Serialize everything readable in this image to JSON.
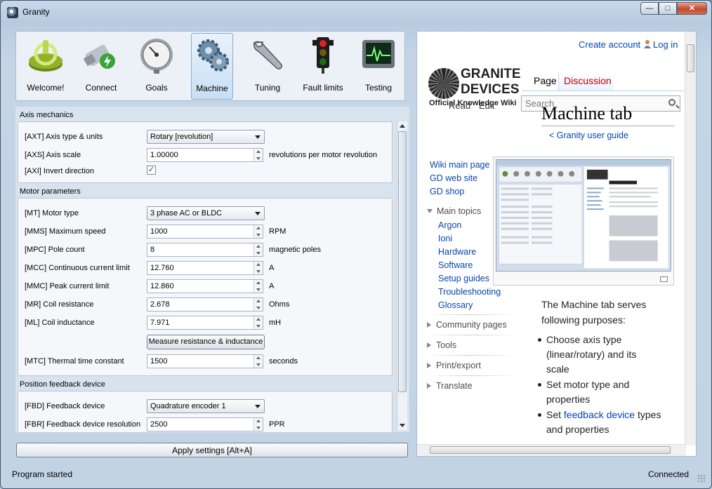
{
  "window": {
    "title": "Granity",
    "controls": [
      "minimize",
      "maximize",
      "close"
    ]
  },
  "toolbar": [
    {
      "label": "Welcome!",
      "icon": "power-icon"
    },
    {
      "label": "Connect",
      "icon": "usb-plug-icon"
    },
    {
      "label": "Goals",
      "icon": "gauge-icon"
    },
    {
      "label": "Machine",
      "icon": "gears-icon",
      "active": true
    },
    {
      "label": "Tuning",
      "icon": "wrench-icon"
    },
    {
      "label": "Fault limits",
      "icon": "traffic-light-icon"
    },
    {
      "label": "Testing",
      "icon": "oscilloscope-icon"
    }
  ],
  "axis": {
    "header": "Axis mechanics",
    "type_label": "[AXT] Axis type & units",
    "type_value": "Rotary [revolution]",
    "scale_label": "[AXS] Axis scale",
    "scale_value": "1.00000",
    "scale_unit": "revolutions per motor revolution",
    "invert_label": "[AXI] Invert direction",
    "invert_checked": true
  },
  "motor": {
    "header": "Motor parameters",
    "type_label": "[MT] Motor type",
    "type_value": "3 phase AC or BLDC",
    "speed_label": "[MMS] Maximum speed",
    "speed_value": "1000",
    "speed_unit": "RPM",
    "poles_label": "[MPC] Pole count",
    "poles_value": "8",
    "poles_unit": "magnetic poles",
    "cont_label": "[MCC] Continuous current limit",
    "cont_value": "12.760",
    "cont_unit": "A",
    "peak_label": "[MMC] Peak current limit",
    "peak_value": "12.860",
    "peak_unit": "A",
    "res_label": "[MR] Coil resistance",
    "res_value": "2.678",
    "res_unit": "Ohms",
    "ind_label": "[ML] Coil inductance",
    "ind_value": "7.971",
    "ind_unit": "mH",
    "measure_button": "Measure resistance & inductance",
    "thermal_label": "[MTC] Thermal time constant",
    "thermal_value": "1500",
    "thermal_unit": "seconds"
  },
  "feedback": {
    "header": "Position feedback device",
    "device_label": "[FBD] Feedback device",
    "device_value": "Quadrature encoder 1",
    "res_label": "[FBR] Feedback device resolution",
    "res_value": "2500",
    "res_unit": "PPR"
  },
  "apply_button": "Apply settings [Alt+A]",
  "status": {
    "left": "Program started",
    "right": "Connected"
  },
  "wiki": {
    "create_account": "Create account",
    "log_in": "Log in",
    "logo_line1": "GRANITE",
    "logo_line2": "DEVICES",
    "logo_line3": "Official Knowledge Wiki",
    "tab_read": "Read",
    "tab_edit": "Edit",
    "tab_page": "Page",
    "tab_discussion": "Discussion",
    "search_placeholder": "Search",
    "page_title": "Machine tab",
    "breadcrumb": "< Granity user guide",
    "nav": [
      "Wiki main page",
      "GD web site",
      "GD shop"
    ],
    "main_topics": "Main topics",
    "topics": [
      "Argon",
      "Ioni",
      "Hardware",
      "Software",
      "Setup guides",
      "Troubleshooting",
      "Glossary"
    ],
    "collapsed": [
      "Community pages",
      "Tools",
      "Print/export",
      "Translate"
    ],
    "intro_line1": "The Machine tab serves",
    "intro_line2": "following purposes:",
    "bullets": {
      "b1_l1": "Choose axis type",
      "b1_l2": "(linear/rotary) and its",
      "b1_l3": "scale",
      "b2_l1": "Set motor type and",
      "b2_l2": "properties",
      "b3_pre": "Set ",
      "b3_link": "feedback device",
      "b3_post": " types",
      "b3_l2": "and properties"
    }
  }
}
